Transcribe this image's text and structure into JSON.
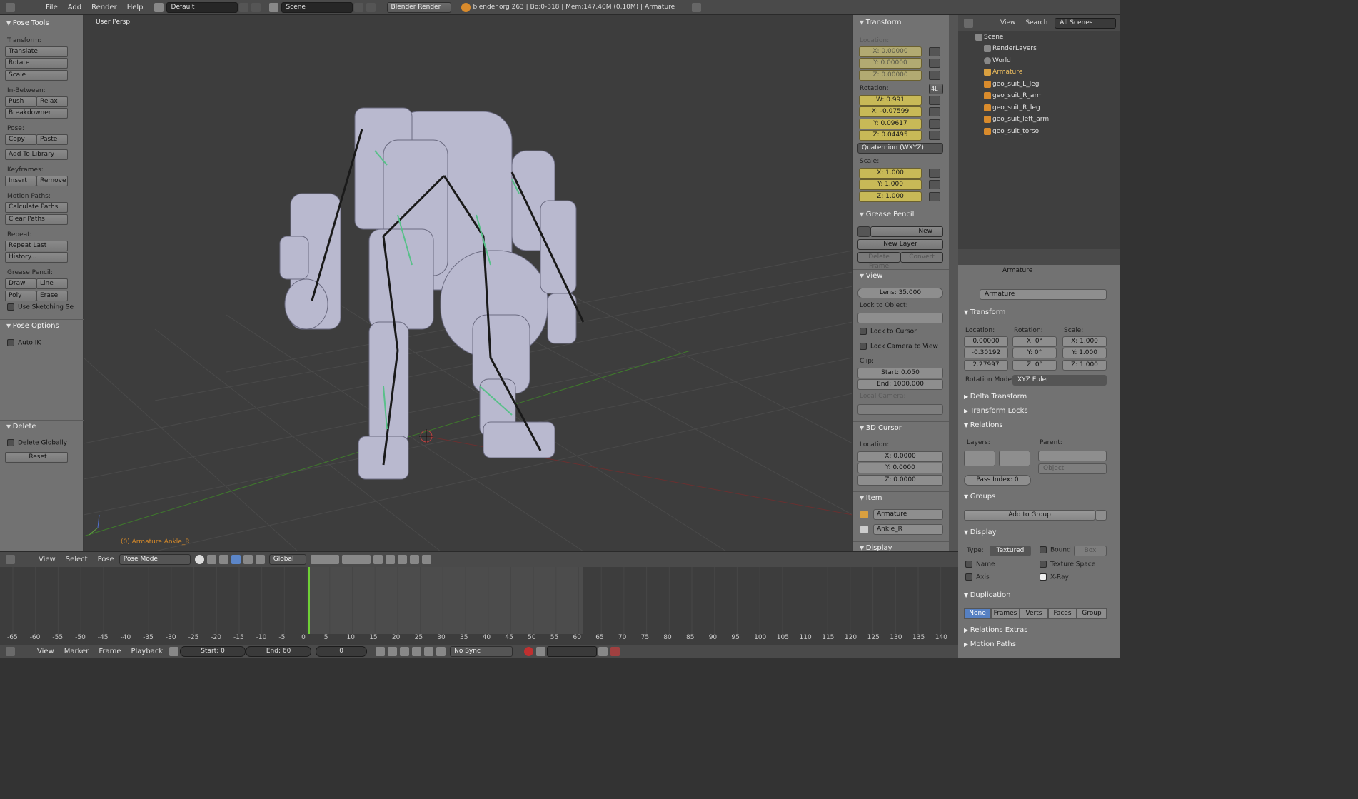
{
  "topbar": {
    "menus": [
      "File",
      "Add",
      "Render",
      "Help"
    ],
    "screen": "Default",
    "scene": "Scene",
    "engine": "Blender Render",
    "info": "blender.org 263 | Bo:0-318 | Mem:147.40M (0.10M) | Armature"
  },
  "tools": {
    "title": "Pose Tools",
    "transform_label": "Transform:",
    "translate": "Translate",
    "rotate": "Rotate",
    "scale": "Scale",
    "inbetween_label": "In-Between:",
    "push": "Push",
    "relax": "Relax",
    "breakdowner": "Breakdowner",
    "pose_label": "Pose:",
    "copy": "Copy",
    "paste": "Paste",
    "add_library": "Add To Library",
    "keyframes_label": "Keyframes:",
    "insert": "Insert",
    "remove": "Remove",
    "motion_label": "Motion Paths:",
    "calc_paths": "Calculate Paths",
    "clear_paths": "Clear Paths",
    "repeat_label": "Repeat:",
    "repeat_last": "Repeat Last",
    "history": "History...",
    "gp_label": "Grease Pencil:",
    "draw": "Draw",
    "line": "Line",
    "poly": "Poly",
    "erase": "Erase",
    "use_sketching": "Use Sketching Se",
    "pose_options": "Pose Options",
    "auto_ik": "Auto IK",
    "delete_title": "Delete",
    "delete_globally": "Delete Globally",
    "reset": "Reset"
  },
  "viewport": {
    "persp": "User Persp",
    "status": "(0) Armature Ankle_R"
  },
  "npanel": {
    "transform": "Transform",
    "location": "Location:",
    "loc": [
      "X: 0.00000",
      "Y: 0.00000",
      "Z: 0.00000"
    ],
    "rotation": "Rotation:",
    "rot_4l": "4L",
    "rot": [
      "W: 0.991",
      "X: -0.07599",
      "Y: 0.09617",
      "Z: 0.04495"
    ],
    "rot_mode": "Quaternion (WXYZ)",
    "scale": "Scale:",
    "scl": [
      "X: 1.000",
      "Y: 1.000",
      "Z: 1.000"
    ],
    "grease": "Grease Pencil",
    "new": "New",
    "new_layer": "New Layer",
    "delete_frame": "Delete Frame",
    "convert": "Convert",
    "view": "View",
    "lens": "Lens: 35.000",
    "lock_obj": "Lock to Object:",
    "lock_cursor": "Lock to Cursor",
    "lock_cam": "Lock Camera to View",
    "clip": "Clip:",
    "clip_start": "Start: 0.050",
    "clip_end": "End: 1000.000",
    "local_cam": "Local Camera:",
    "cursor": "3D Cursor",
    "cursor_loc": "Location:",
    "cur": [
      "X: 0.0000",
      "Y: 0.0000",
      "Z: 0.0000"
    ],
    "item": "Item",
    "item_obj": "Armature",
    "item_bone": "Ankle_R",
    "display": "Display"
  },
  "outliner": {
    "view": "View",
    "search": "Search",
    "scenes": "All Scenes",
    "rows": [
      "Scene",
      "RenderLayers",
      "World",
      "Armature",
      "geo_suit_L_leg",
      "geo_suit_R_arm",
      "geo_suit_R_leg",
      "geo_suit_left_arm",
      "geo_suit_torso"
    ]
  },
  "props": {
    "breadcrumb": "Armature",
    "name": "Armature",
    "transform": "Transform",
    "location": "Location:",
    "rotation": "Rotation:",
    "scale": "Scale:",
    "loc": [
      "0.00000",
      "-0.30192",
      "2.27997"
    ],
    "rot": [
      "X: 0°",
      "Y: 0°",
      "Z: 0°"
    ],
    "scl": [
      "X: 1.000",
      "Y: 1.000",
      "Z: 1.000"
    ],
    "rot_mode_label": "Rotation Mode",
    "rot_mode": "XYZ Euler",
    "delta": "Delta Transform",
    "locks": "Transform Locks",
    "relations": "Relations",
    "layers": "Layers:",
    "parent": "Parent:",
    "object": "Object",
    "pass_index": "Pass Index: 0",
    "groups": "Groups",
    "add_group": "Add to Group",
    "display": "Display",
    "type_label": "Type:",
    "type": "Textured",
    "bound": "Bound",
    "box": "Box",
    "name_chk": "Name",
    "texture_space": "Texture Space",
    "axis": "Axis",
    "xray": "X-Ray",
    "duplication": "Duplication",
    "dup": [
      "None",
      "Frames",
      "Verts",
      "Faces",
      "Group"
    ],
    "rel_extras": "Relations Extras",
    "motion_paths": "Motion Paths"
  },
  "vheader": {
    "view": "View",
    "select": "Select",
    "pose": "Pose",
    "mode": "Pose Mode",
    "orientation": "Global"
  },
  "timeline": {
    "ticks": [
      "-65",
      "-60",
      "-55",
      "-50",
      "-45",
      "-40",
      "-35",
      "-30",
      "-25",
      "-20",
      "-15",
      "-10",
      "-5",
      "0",
      "5",
      "10",
      "15",
      "20",
      "25",
      "30",
      "35",
      "40",
      "45",
      "50",
      "55",
      "60",
      "65",
      "70",
      "75",
      "80",
      "85",
      "90",
      "95",
      "100",
      "105",
      "110",
      "115",
      "120",
      "125",
      "130",
      "135",
      "140"
    ],
    "current_frame": 0,
    "menus": [
      "View",
      "Marker",
      "Frame",
      "Playback"
    ],
    "start": "Start: 0",
    "end": "End: 60",
    "frame": "0",
    "sync": "No Sync"
  }
}
